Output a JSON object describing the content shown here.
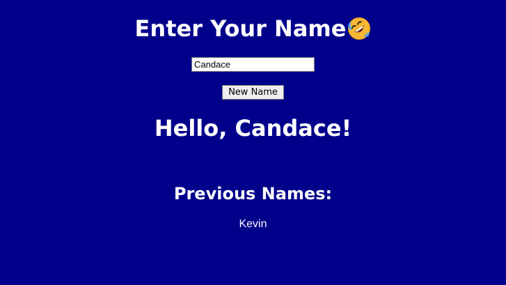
{
  "header": {
    "title": "Enter Your Name",
    "emoji_icon": "rolling-on-floor-laughing-emoji-icon"
  },
  "form": {
    "name_input_value": "Candace",
    "submit_label": "New Name"
  },
  "greeting": {
    "text": "Hello, Candace!"
  },
  "previous": {
    "heading": "Previous Names:",
    "names": [
      "Kevin"
    ]
  },
  "colors": {
    "background": "#00008b",
    "text": "#ffffff"
  }
}
